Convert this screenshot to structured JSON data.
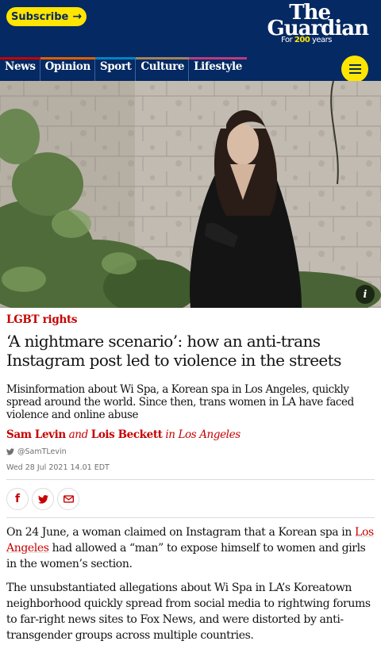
{
  "header": {
    "subscribe_label": "Subscribe",
    "subscribe_arrow": "→",
    "logo_the": "The",
    "logo_guardian": "Guardian",
    "logo_tag_prefix": "For ",
    "logo_tag_number": "200",
    "logo_tag_suffix": " years"
  },
  "nav": {
    "items": [
      {
        "label": "News",
        "color": "#c70000"
      },
      {
        "label": "Opinion",
        "color": "#e05e00"
      },
      {
        "label": "Sport",
        "color": "#0084c6"
      },
      {
        "label": "Culture",
        "color": "#a1845c"
      },
      {
        "label": "Lifestyle",
        "color": "#bb3b80"
      }
    ],
    "menu_icon": "hamburger-icon"
  },
  "hero": {
    "info_label": "i"
  },
  "article": {
    "kicker": "LGBT rights",
    "headline": "‘A nightmare scenario’: how an anti-trans Instagram post led to violence in the streets",
    "standfirst": "Misinformation about Wi Spa, a Korean spa in Los Angeles, quickly spread around the world. Since then, trans women in LA have faced violence and online abuse",
    "byline": {
      "author1": "Sam Levin",
      "and": " and ",
      "author2": "Lois Beckett",
      "location": " in Los Angeles"
    },
    "twitter_handle": "@SamTLevin",
    "date": "Wed 28 Jul 2021 14.01 EDT",
    "share": {
      "facebook": "f",
      "twitter": "twitter-icon",
      "email": "email-icon"
    },
    "body": {
      "p1_before": "On 24 June, a woman claimed on Instagram that a Korean spa in ",
      "p1_link": "Los Angeles",
      "p1_after": " had allowed a “man” to expose himself to women and girls in the women’s section.",
      "p2": "The unsubstantiated allegations about Wi Spa in LA’s Koreatown neighborhood quickly spread from social media to rightwing forums to far-right news sites to Fox News, and were distorted by anti-transgender groups across multiple countries."
    }
  },
  "colors": {
    "brand_blue": "#052962",
    "brand_yellow": "#ffe500",
    "news_red": "#c70000"
  }
}
